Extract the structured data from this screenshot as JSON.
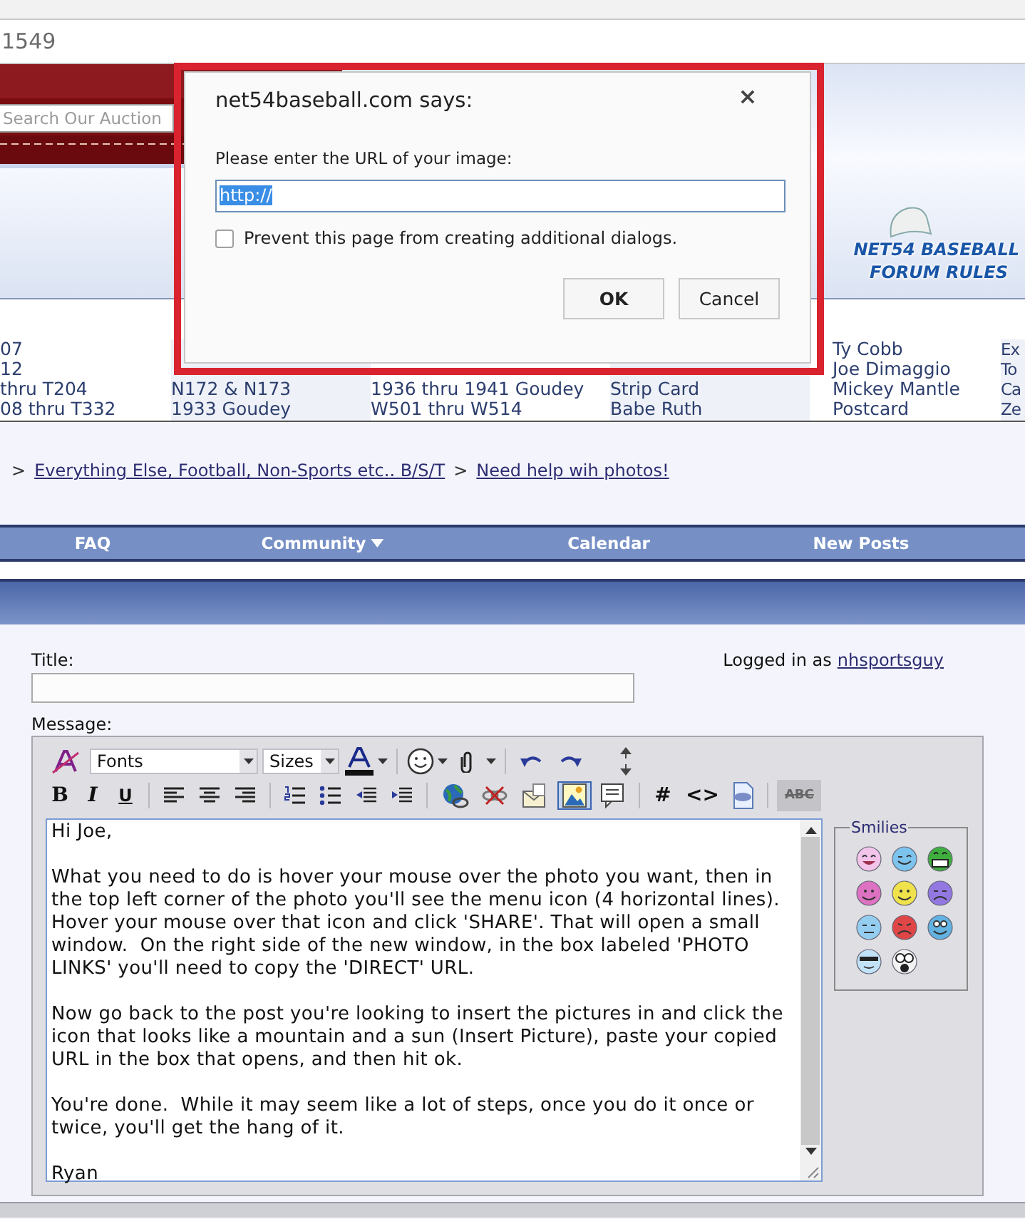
{
  "browser": {
    "address": "1549"
  },
  "header": {
    "search": {
      "placeholder": "Search Our Auction"
    },
    "logo": {
      "line_1": "NET54 BASEBALL",
      "line_2": "FORUM RULES"
    }
  },
  "category_links": [
    {
      "items": [
        "07",
        "12",
        "thru T204",
        "08 thru T332"
      ]
    },
    {
      "items": [
        "N172 & N173",
        "1933 Goudey"
      ]
    },
    {
      "items": [
        "1936 thru 1941 Goudey",
        "W501 thru W514"
      ]
    },
    {
      "items": [
        "Strip Card",
        "Babe Ruth"
      ]
    },
    {
      "items": [
        "Ty Cobb",
        "Joe Dimaggio",
        "Mickey Mantle",
        "Postcard"
      ]
    },
    {
      "items": [
        "Ex",
        "To",
        "Ca",
        "Ze"
      ]
    }
  ],
  "breadcrumb": {
    "links": [
      "Everything Else, Football, Non-Sports etc.. B/S/T",
      "Need help wih photos!"
    ],
    "separators": [
      ">"
    ],
    "leading_separator": ">"
  },
  "nav": [
    {
      "label": "FAQ",
      "has_menu": false
    },
    {
      "label": "Community",
      "has_menu": true
    },
    {
      "label": "Calendar",
      "has_menu": false
    },
    {
      "label": "New Posts",
      "has_menu": false
    }
  ],
  "form": {
    "title_label": "Title:",
    "logged_in_label": "Logged in as",
    "username": "nhsportsguy",
    "message_label": "Message:"
  },
  "toolbar": {
    "row_1": [
      {
        "kind": "remove-format"
      },
      {
        "kind": "select",
        "label": "Fonts"
      },
      {
        "kind": "select",
        "label": "Sizes"
      },
      {
        "kind": "text-color"
      },
      {
        "kind": "separator"
      },
      {
        "kind": "smiley"
      },
      {
        "kind": "attach"
      },
      {
        "kind": "separator"
      },
      {
        "kind": "undo"
      },
      {
        "kind": "redo"
      },
      {
        "kind": "resize"
      }
    ],
    "row_2": [
      {
        "kind": "bold",
        "label": "B",
        "selected": false
      },
      {
        "kind": "italic",
        "label": "I",
        "selected": false
      },
      {
        "kind": "underline",
        "label": "U",
        "selected": false
      },
      {
        "kind": "separator"
      },
      {
        "kind": "align-left",
        "selected": false
      },
      {
        "kind": "align-center",
        "selected": false
      },
      {
        "kind": "align-right",
        "selected": false
      },
      {
        "kind": "separator"
      },
      {
        "kind": "numbered-list",
        "selected": false
      },
      {
        "kind": "bullet-list",
        "selected": false
      },
      {
        "kind": "outdent",
        "selected": false
      },
      {
        "kind": "indent",
        "selected": false
      },
      {
        "kind": "separator"
      },
      {
        "kind": "link",
        "selected": false
      },
      {
        "kind": "unlink",
        "selected": false
      },
      {
        "kind": "email",
        "selected": false
      },
      {
        "kind": "image",
        "selected": true
      },
      {
        "kind": "quote",
        "selected": false
      },
      {
        "kind": "separator"
      },
      {
        "kind": "hash",
        "label": "#",
        "selected": false
      },
      {
        "kind": "code",
        "label": "<>",
        "selected": false
      },
      {
        "kind": "php",
        "selected": false
      },
      {
        "kind": "separator"
      },
      {
        "kind": "spell",
        "label": "ABC",
        "selected": false
      }
    ]
  },
  "message": {
    "paragraphs": [
      "Hi Joe,",
      "What you need to do is hover your mouse over the photo you want, then in the top left corner of the photo you'll see the menu icon (4 horizontal lines). Hover your mouse over that icon and click 'SHARE'. That will open a small window.  On the right side of the new window, in the box labeled 'PHOTO LINKS' you'll need to copy the 'DIRECT' URL.",
      "Now go back to the post you're looking to insert the pictures in and click the icon that looks like a mountain and a sun (Insert Picture), paste your copied URL in the box that opens, and then hit ok.",
      "You're done.  While it may seem like a lot of steps, once you do it once or twice, you'll get the hang of it.",
      "Ryan"
    ]
  },
  "smilies": {
    "legend": "Smilies",
    "items": [
      {
        "color": "#f2c4ea"
      },
      {
        "color": "#7cc4ee"
      },
      {
        "color": "#3fae3f"
      },
      {
        "color": "#de72c2"
      },
      {
        "color": "#f0e24a"
      },
      {
        "color": "#9478e2"
      },
      {
        "color": "#94cdf0"
      },
      {
        "color": "#e04646"
      },
      {
        "color": "#62b2e2"
      },
      {
        "color": "#c2e2f8"
      },
      {
        "color": "#f2f2f2"
      }
    ]
  },
  "dialog": {
    "title": "net54baseball.com says:",
    "close": "×",
    "prompt": "Please enter the URL of your image:",
    "value": "http://",
    "value_selected": true,
    "checkbox": {
      "label": "Prevent this page from creating additional dialogs.",
      "checked": false
    },
    "buttons": [
      {
        "label": "OK",
        "default": true
      },
      {
        "label": "Cancel",
        "default": false
      }
    ]
  }
}
